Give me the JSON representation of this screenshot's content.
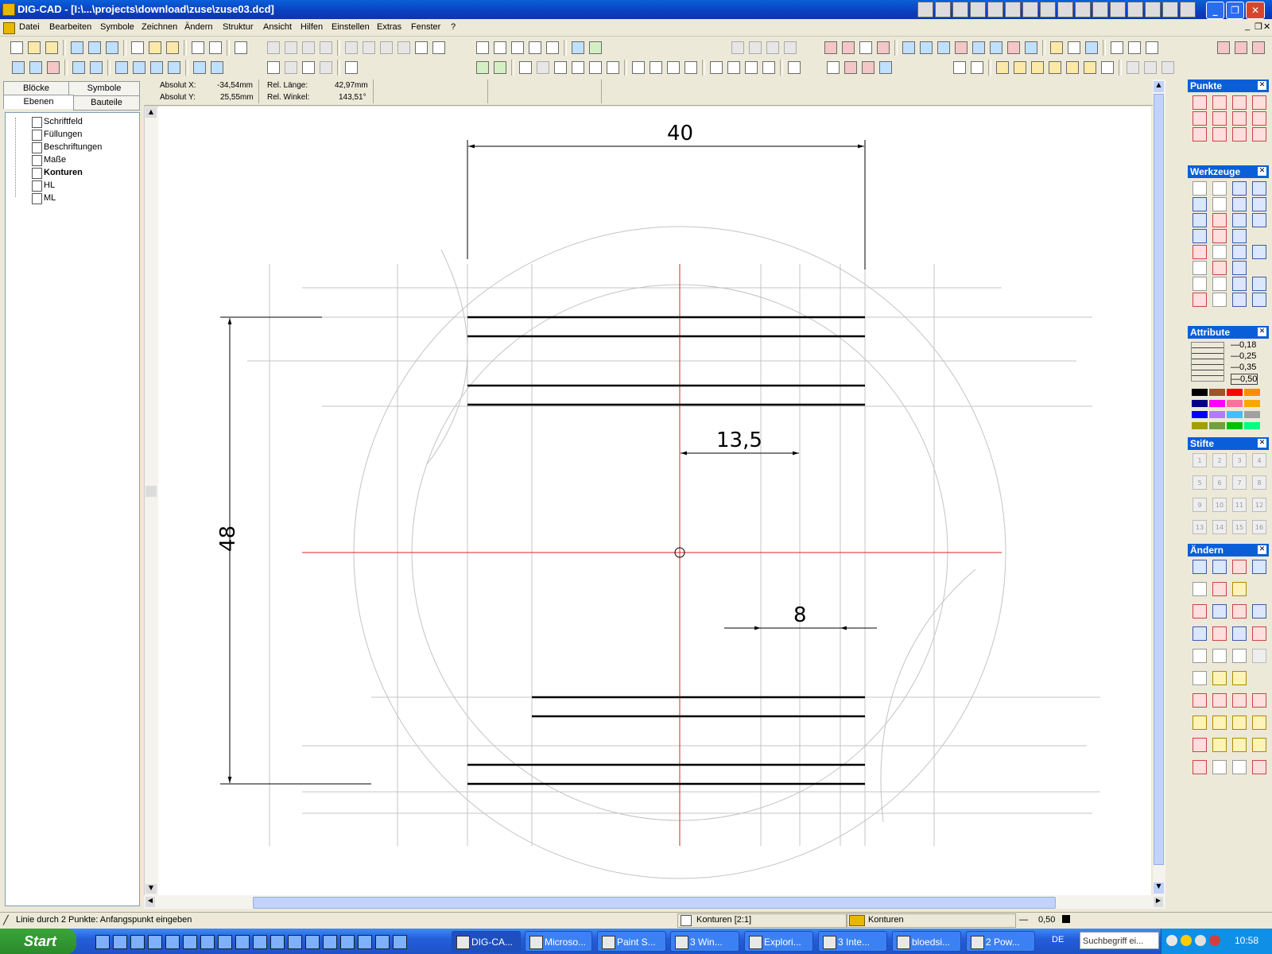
{
  "window": {
    "title": "DIG-CAD - [I:\\...\\projects\\download\\zuse\\zuse03.dcd]"
  },
  "menu": [
    "Datei",
    "Bearbeiten",
    "Symbole",
    "Zeichnen",
    "Ändern",
    "Struktur",
    "Ansicht",
    "Hilfen",
    "Einstellen",
    "Extras",
    "Fenster",
    "?"
  ],
  "left_panel": {
    "tabs_top": [
      "Blöcke",
      "Symbole"
    ],
    "tabs_bottom": [
      "Ebenen",
      "Bauteile"
    ],
    "layers": [
      {
        "name": "Schriftfeld",
        "active": false
      },
      {
        "name": "Füllungen",
        "active": false
      },
      {
        "name": "Beschriftungen",
        "active": false
      },
      {
        "name": "Maße",
        "active": false
      },
      {
        "name": "Konturen",
        "active": true
      },
      {
        "name": "HL",
        "active": false
      },
      {
        "name": "ML",
        "active": false
      }
    ]
  },
  "coords": {
    "abs_x_label": "Absolut X:",
    "abs_x": "-34,54mm",
    "abs_y_label": "Absolut Y:",
    "abs_y": "25,55mm",
    "rel_len_label": "Rel. Länge:",
    "rel_len": "42,97mm",
    "rel_angle_label": "Rel. Winkel:",
    "rel_angle": "143,51°"
  },
  "drawing": {
    "dim_top": "40",
    "dim_left": "48",
    "dim_mid": "13,5",
    "dim_small": "8"
  },
  "palettes": {
    "punkte": "Punkte",
    "werkzeuge": "Werkzeuge",
    "attribute": "Attribute",
    "stifte": "Stifte",
    "aendern": "Ändern",
    "line_widths": [
      "0,18",
      "0,25",
      "0,35",
      "0,50"
    ],
    "pens": [
      "1",
      "2",
      "3",
      "4",
      "5",
      "6",
      "7",
      "8",
      "9",
      "10",
      "11",
      "12",
      "13",
      "14",
      "15",
      "16"
    ],
    "colors": [
      "#000000",
      "#a0522d",
      "#ff0000",
      "#ff8c00",
      "#00008b",
      "#ff00ff",
      "#ff6fa0",
      "#ffa500",
      "#0000ff",
      "#b07cff",
      "#40c0ff",
      "#a0a0a0",
      "#a0a000",
      "#70a040",
      "#00c000",
      "#00ff80"
    ]
  },
  "status": {
    "prompt": "Linie durch 2 Punkte: Anfangspunkt eingeben",
    "layer_scale": "Konturen [2:1]",
    "layer": "Konturen",
    "width": "0,50"
  },
  "taskbar": {
    "start": "Start",
    "tasks": [
      "DIG-CA...",
      "Microso...",
      "Paint S...",
      "3 Win...",
      "Explori...",
      "3 Inte...",
      "bloedsi...",
      "2 Pow..."
    ],
    "lang": "DE",
    "search": "Suchbegriff ei...",
    "clock": "10:58"
  },
  "colors": {
    "titlebar": "#0a5fd8",
    "centerline": "#ff0000",
    "construction": "#b8b8b8",
    "contour": "#000000"
  }
}
